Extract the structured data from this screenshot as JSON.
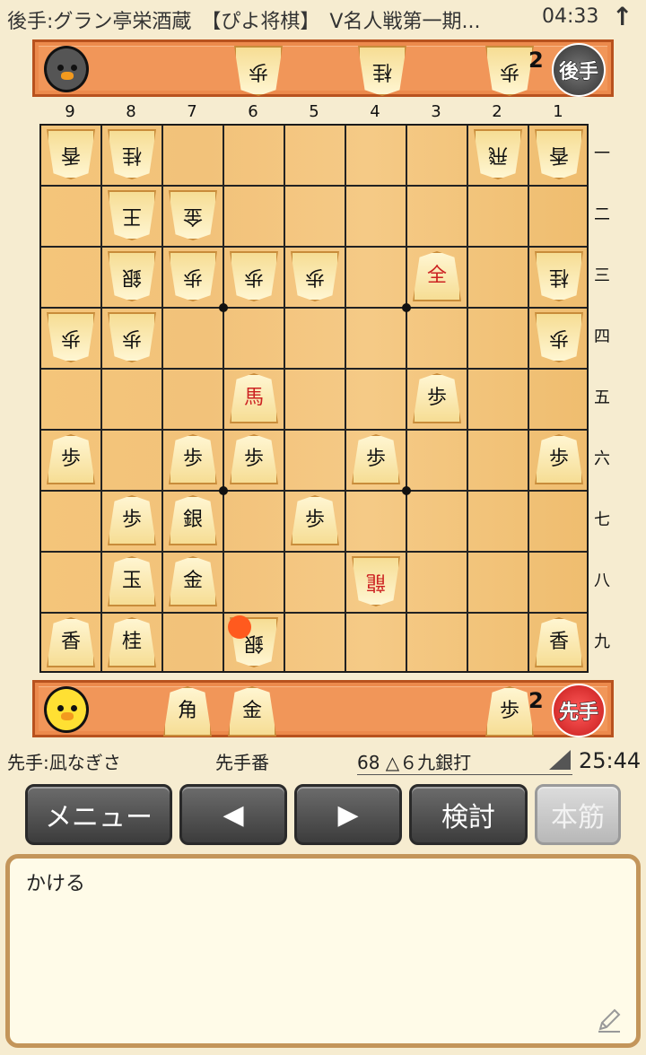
{
  "header": {
    "title": "後手:グラン亭栄酒蔵　【ぴよ将棋】　V名人戦第一期...",
    "time": "04:33",
    "arrow_glyph": "↑"
  },
  "gote_stand": {
    "pieces": [
      {
        "label": "歩"
      },
      {
        "label": "桂"
      },
      {
        "label": "歩",
        "count": "2"
      }
    ],
    "badge": "後手"
  },
  "sente_stand": {
    "pieces": [
      {
        "label": "角"
      },
      {
        "label": "金"
      },
      {
        "label": "歩",
        "count": "2"
      }
    ],
    "badge": "先手"
  },
  "file_labels": [
    "9",
    "8",
    "7",
    "6",
    "5",
    "4",
    "3",
    "2",
    "1"
  ],
  "rank_labels": [
    "一",
    "二",
    "三",
    "四",
    "五",
    "六",
    "七",
    "八",
    "九"
  ],
  "board": {
    "pieces": [
      {
        "label": "香",
        "side": "gote",
        "file": 9,
        "rank": 1
      },
      {
        "label": "桂",
        "side": "gote",
        "file": 8,
        "rank": 1
      },
      {
        "label": "飛",
        "side": "gote",
        "file": 2,
        "rank": 1
      },
      {
        "label": "香",
        "side": "gote",
        "file": 1,
        "rank": 1
      },
      {
        "label": "王",
        "side": "gote",
        "file": 8,
        "rank": 2
      },
      {
        "label": "金",
        "side": "gote",
        "file": 7,
        "rank": 2
      },
      {
        "label": "銀",
        "side": "gote",
        "file": 8,
        "rank": 3
      },
      {
        "label": "歩",
        "side": "gote",
        "file": 7,
        "rank": 3
      },
      {
        "label": "歩",
        "side": "gote",
        "file": 6,
        "rank": 3
      },
      {
        "label": "歩",
        "side": "gote",
        "file": 5,
        "rank": 3
      },
      {
        "label": "全",
        "side": "sente",
        "file": 3,
        "rank": 3,
        "red": true
      },
      {
        "label": "桂",
        "side": "gote",
        "file": 1,
        "rank": 3
      },
      {
        "label": "歩",
        "side": "gote",
        "file": 9,
        "rank": 4
      },
      {
        "label": "歩",
        "side": "gote",
        "file": 8,
        "rank": 4
      },
      {
        "label": "歩",
        "side": "gote",
        "file": 1,
        "rank": 4
      },
      {
        "label": "馬",
        "side": "sente",
        "file": 6,
        "rank": 5,
        "red": true
      },
      {
        "label": "歩",
        "side": "sente",
        "file": 3,
        "rank": 5
      },
      {
        "label": "歩",
        "side": "sente",
        "file": 9,
        "rank": 6
      },
      {
        "label": "歩",
        "side": "sente",
        "file": 7,
        "rank": 6
      },
      {
        "label": "歩",
        "side": "sente",
        "file": 6,
        "rank": 6
      },
      {
        "label": "歩",
        "side": "sente",
        "file": 4,
        "rank": 6
      },
      {
        "label": "歩",
        "side": "sente",
        "file": 1,
        "rank": 6
      },
      {
        "label": "歩",
        "side": "sente",
        "file": 8,
        "rank": 7
      },
      {
        "label": "銀",
        "side": "sente",
        "file": 7,
        "rank": 7
      },
      {
        "label": "歩",
        "side": "sente",
        "file": 5,
        "rank": 7
      },
      {
        "label": "玉",
        "side": "sente",
        "file": 8,
        "rank": 8
      },
      {
        "label": "金",
        "side": "sente",
        "file": 7,
        "rank": 8
      },
      {
        "label": "龍",
        "side": "gote",
        "file": 4,
        "rank": 8,
        "red": true
      },
      {
        "label": "香",
        "side": "sente",
        "file": 9,
        "rank": 9
      },
      {
        "label": "桂",
        "side": "sente",
        "file": 8,
        "rank": 9
      },
      {
        "label": "銀",
        "side": "gote",
        "file": 6,
        "rank": 9
      },
      {
        "label": "香",
        "side": "sente",
        "file": 1,
        "rank": 9
      }
    ],
    "last_move": {
      "file": 6,
      "rank": 9
    }
  },
  "status": {
    "sente_name": "先手:凪なぎさ",
    "turn": "先手番",
    "move": "68 △６九銀打",
    "time": "25:44"
  },
  "buttons": {
    "menu": "メニュー",
    "prev": "◀",
    "next": "▶",
    "analyze": "検討",
    "mainline": "本筋"
  },
  "comment": {
    "text": "かける"
  }
}
